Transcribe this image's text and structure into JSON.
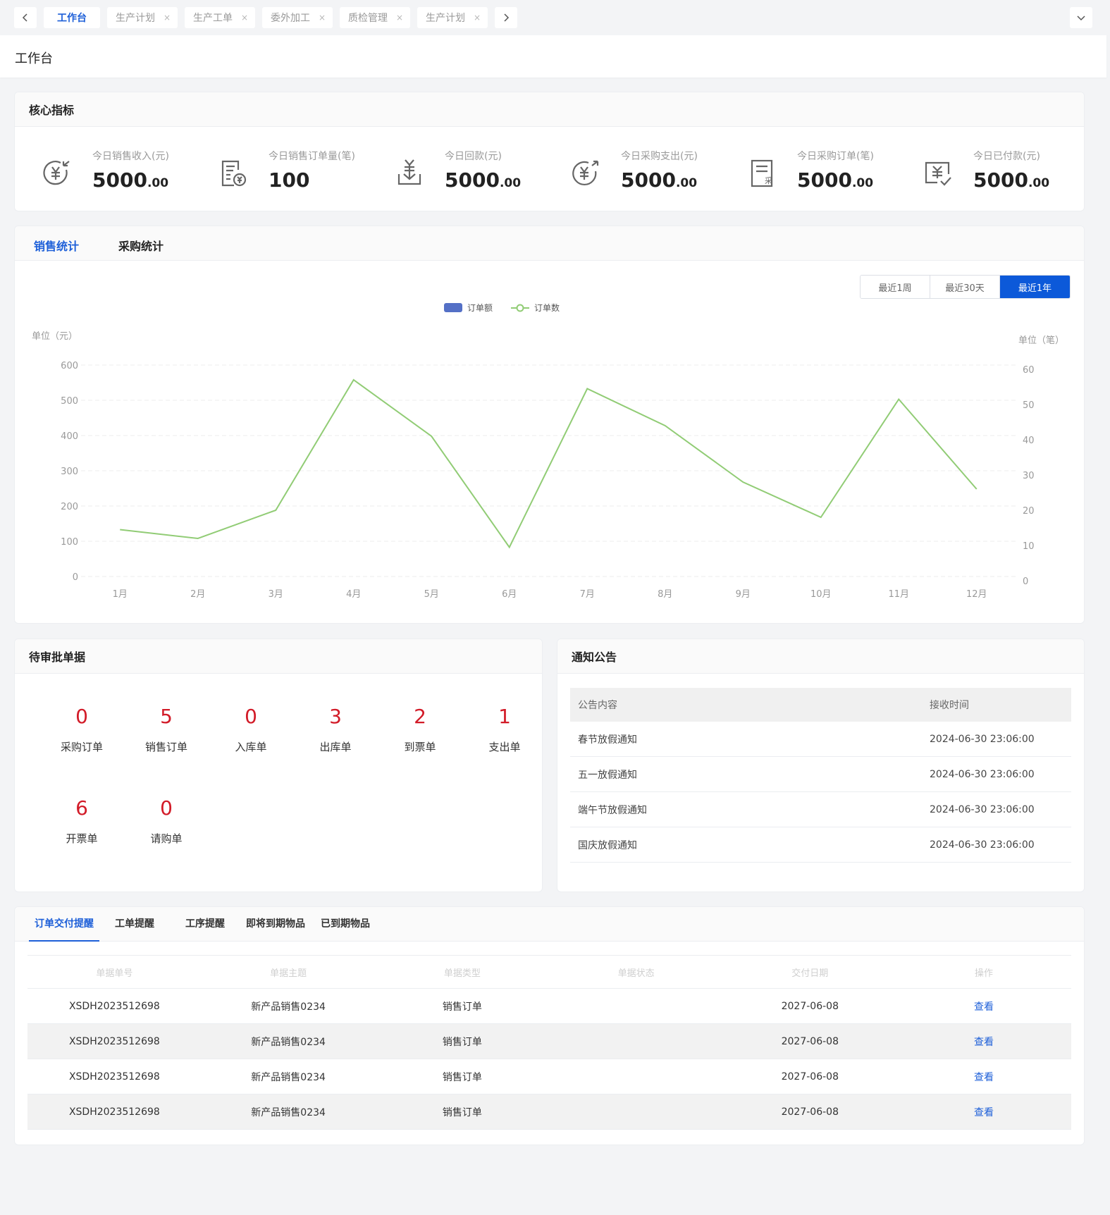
{
  "tabs": [
    {
      "label": "工作台",
      "active": true
    },
    {
      "label": "生产计划",
      "active": false
    },
    {
      "label": "生产工单",
      "active": false
    },
    {
      "label": "委外加工",
      "active": false
    },
    {
      "label": "质检管理",
      "active": false
    },
    {
      "label": "生产计划",
      "active": false
    }
  ],
  "tab_close_glyph": "×",
  "page_title": "工作台",
  "kpi": {
    "title": "核心指标",
    "items": [
      {
        "label": "今日销售收入(元)",
        "int": "5000",
        "dec": ".00",
        "icon": "yen-in-icon"
      },
      {
        "label": "今日销售订单量(笔)",
        "int": "100",
        "dec": "",
        "icon": "invoice-yen-icon"
      },
      {
        "label": "今日回款(元)",
        "int": "5000",
        "dec": ".00",
        "icon": "yen-download-icon"
      },
      {
        "label": "今日采购支出(元)",
        "int": "5000",
        "dec": ".00",
        "icon": "yen-out-icon"
      },
      {
        "label": "今日采购订单(笔)",
        "int": "5000",
        "dec": ".00",
        "icon": "purchase-doc-icon"
      },
      {
        "label": "今日已付款(元)",
        "int": "5000",
        "dec": ".00",
        "icon": "yen-paid-icon"
      }
    ],
    "purchase_glyph": "采"
  },
  "stats": {
    "tabs": [
      "销售统计",
      "采购统计"
    ],
    "ranges": [
      "最近1周",
      "最近30天",
      "最近1年"
    ],
    "active_range": 2
  },
  "chart_data": {
    "type": "line",
    "categories": [
      "1月",
      "2月",
      "3月",
      "4月",
      "5月",
      "6月",
      "7月",
      "8月",
      "9月",
      "10月",
      "11月",
      "12月"
    ],
    "series": [
      {
        "name": "订单额",
        "type": "bar",
        "axis": "left",
        "values": [],
        "color": "#5470c6"
      },
      {
        "name": "订单数",
        "type": "line",
        "axis": "right",
        "values": [
          14.5,
          12,
          20,
          57,
          41,
          9.5,
          54.5,
          44,
          28,
          18,
          51.5,
          26
        ],
        "color": "#91cc75"
      }
    ],
    "ylabel": "单位（元）",
    "ylabel_right": "单位（笔）",
    "ylim": [
      0,
      600
    ],
    "yticks": [
      0,
      100,
      200,
      300,
      400,
      500,
      600
    ],
    "ylim_right": [
      0,
      60
    ],
    "yticks_right": [
      0,
      10,
      20,
      30,
      40,
      50,
      60
    ],
    "grid": true,
    "legend": "top-center"
  },
  "approval": {
    "title": "待审批单据",
    "items": [
      {
        "count": "0",
        "label": "采购订单"
      },
      {
        "count": "5",
        "label": "销售订单"
      },
      {
        "count": "0",
        "label": "入库单"
      },
      {
        "count": "3",
        "label": "出库单"
      },
      {
        "count": "2",
        "label": "到票单"
      },
      {
        "count": "1",
        "label": "支出单"
      },
      {
        "count": "6",
        "label": "开票单"
      },
      {
        "count": "0",
        "label": "请购单"
      }
    ]
  },
  "notice": {
    "title": "通知公告",
    "columns": [
      "公告内容",
      "接收时间"
    ],
    "rows": [
      [
        "春节放假通知",
        "2024-06-30 23:06:00"
      ],
      [
        "五一放假通知",
        "2024-06-30 23:06:00"
      ],
      [
        "端午节放假通知",
        "2024-06-30 23:06:00"
      ],
      [
        "国庆放假通知",
        "2024-06-30 23:06:00"
      ]
    ]
  },
  "reminder": {
    "tabs": [
      "订单交付提醒",
      "工单提醒",
      "工序提醒",
      "即将到期物品",
      "已到期物品"
    ],
    "columns": [
      "单据单号",
      "单据主题",
      "单据类型",
      "单据状态",
      "交付日期",
      "操作"
    ],
    "rows": [
      [
        "XSDH2023512698",
        "新产品销售0234",
        "销售订单",
        "",
        "2027-06-08",
        "查看"
      ],
      [
        "XSDH2023512698",
        "新产品销售0234",
        "销售订单",
        "",
        "2027-06-08",
        "查看"
      ],
      [
        "XSDH2023512698",
        "新产品销售0234",
        "销售订单",
        "",
        "2027-06-08",
        "查看"
      ],
      [
        "XSDH2023512698",
        "新产品销售0234",
        "销售订单",
        "",
        "2027-06-08",
        "查看"
      ]
    ]
  },
  "colors": {
    "accent": "#1d5fd8",
    "danger": "#d21b28",
    "line": "#91cc75",
    "bar": "#5470c6"
  }
}
